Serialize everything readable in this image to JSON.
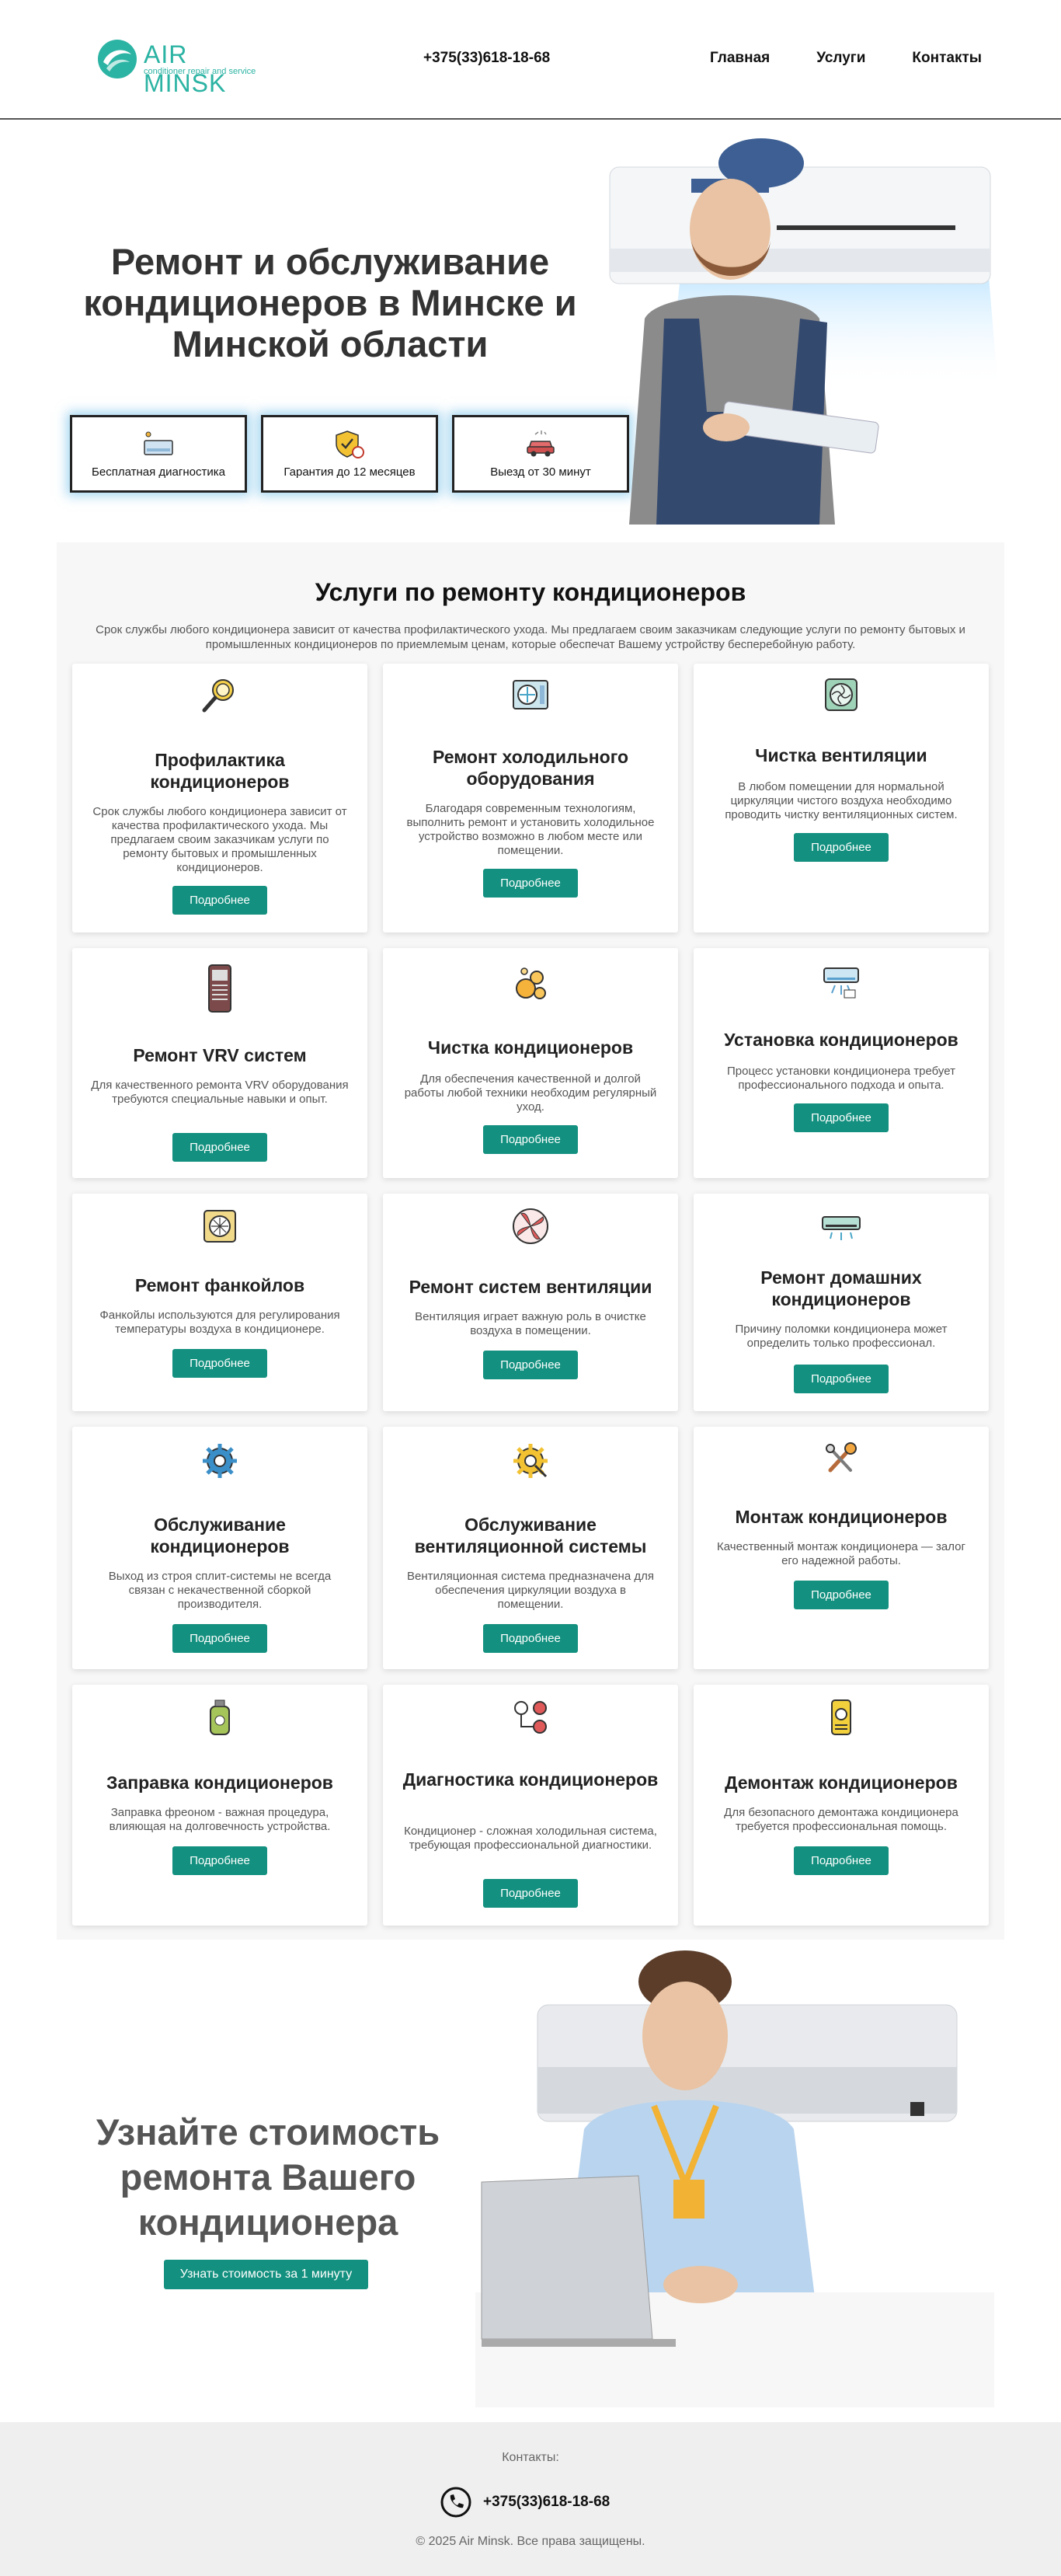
{
  "brand": {
    "name": "AIR MINSK",
    "tagline": "conditioner repair and service"
  },
  "header": {
    "phone": "+375(33)618-18-68",
    "nav": [
      "Главная",
      "Услуги",
      "Контакты"
    ]
  },
  "hero": {
    "title": "Ремонт и обслуживание кондиционеров в Минске и Минской области",
    "features": [
      {
        "label": "Бесплатная диагностика",
        "icon": "diagnostics-icon"
      },
      {
        "label": "Гарантия до 12 месяцев",
        "icon": "warranty-shield-icon"
      },
      {
        "label": "Выезд от 30 минут",
        "icon": "car-icon"
      }
    ]
  },
  "services": {
    "title": "Услуги по ремонту кондиционеров",
    "description": "Срок службы любого кондиционера зависит от качества профилактического ухода. Мы предлагаем своим заказчикам следующие услуги по ремонту бытовых и промышленных кондиционеров по приемлемым ценам, которые обеспечат Вашему устройству бесперебойную работу.",
    "button_label": "Подробнее",
    "items": [
      {
        "title": "Профилактика кондиционеров",
        "text": "Срок службы любого кондиционера зависит от качества профилактического ухода. Мы предлагаем своим заказчикам услуги по ремонту бытовых и промышленных кондиционеров.",
        "icon": "magnifier-icon"
      },
      {
        "title": "Ремонт холодильного оборудования",
        "text": "Благодаря современным технологиям, выполнить ремонт и установить холодильное устройство возможно в любом месте или помещении.",
        "icon": "outdoor-unit-icon"
      },
      {
        "title": "Чистка вентиляции",
        "text": "В любом помещении для нормальной циркуляции чистого воздуха необходимо проводить чистку вентиляционных систем.",
        "icon": "vent-fan-icon"
      },
      {
        "title": "Ремонт VRV систем",
        "text": "Для качественного ремонта VRV оборудования требуются специальные навыки и опыт.",
        "icon": "vrv-unit-icon"
      },
      {
        "title": "Чистка кондиционеров",
        "text": "Для обеспечения качественной и долгой работы любой техники необходим регулярный уход.",
        "icon": "bubbles-icon"
      },
      {
        "title": "Установка кондиционеров",
        "text": "Процесс установки кондиционера требует профессионального подхода и опыта.",
        "icon": "ac-install-icon"
      },
      {
        "title": "Ремонт фанкойлов",
        "text": "Фанкойлы используются для регулирования температуры воздуха в кондиционере.",
        "icon": "fancoil-icon"
      },
      {
        "title": "Ремонт систем вентиляции",
        "text": "Вентиляция играет важную роль в очистке воздуха в помещении.",
        "icon": "fan-blades-icon"
      },
      {
        "title": "Ремонт домашних кондиционеров",
        "text": "Причину поломки кондиционера может определить только профессионал.",
        "icon": "split-ac-icon"
      },
      {
        "title": "Обслуживание кондиционеров",
        "text": "Выход из строя сплит-системы не всегда связан с некачественной сборкой производителя.",
        "icon": "gear-blue-icon"
      },
      {
        "title": "Обслуживание вентиляционной системы",
        "text": "Вентиляционная система предназначена для обеспечения циркуляции воздуха в помещении.",
        "icon": "gear-wrench-icon"
      },
      {
        "title": "Монтаж кондиционеров",
        "text": "Качественный монтаж кондиционера — залог его надежной работы.",
        "icon": "tools-icon"
      },
      {
        "title": "Заправка кондиционеров",
        "text": "Заправка фреоном - важная процедура, влияющая на долговечность устройства.",
        "icon": "freon-canister-icon"
      },
      {
        "title": "Диагностика кондиционеров",
        "text": "Кондиционер - сложная холодильная система, требующая профессиональной диагностики.",
        "icon": "diagnostic-gears-icon"
      },
      {
        "title": "Демонтаж кондиционеров",
        "text": "Для безопасного демонтажа кондиционера требуется профессиональная помощь.",
        "icon": "dismantle-icon"
      }
    ]
  },
  "cta": {
    "title": "Узнайте стоимость ремонта Вашего кондиционера",
    "button_label": "Узнать стоимость за 1 минуту"
  },
  "footer": {
    "contacts_label": "Контакты:",
    "phone": "+375(33)618-18-68",
    "copyright": "© 2025 Air Minsk. Все права защищены."
  },
  "colors": {
    "accent": "#13907f",
    "brand": "#2bb3a3",
    "panel": "#f7f7f7"
  }
}
